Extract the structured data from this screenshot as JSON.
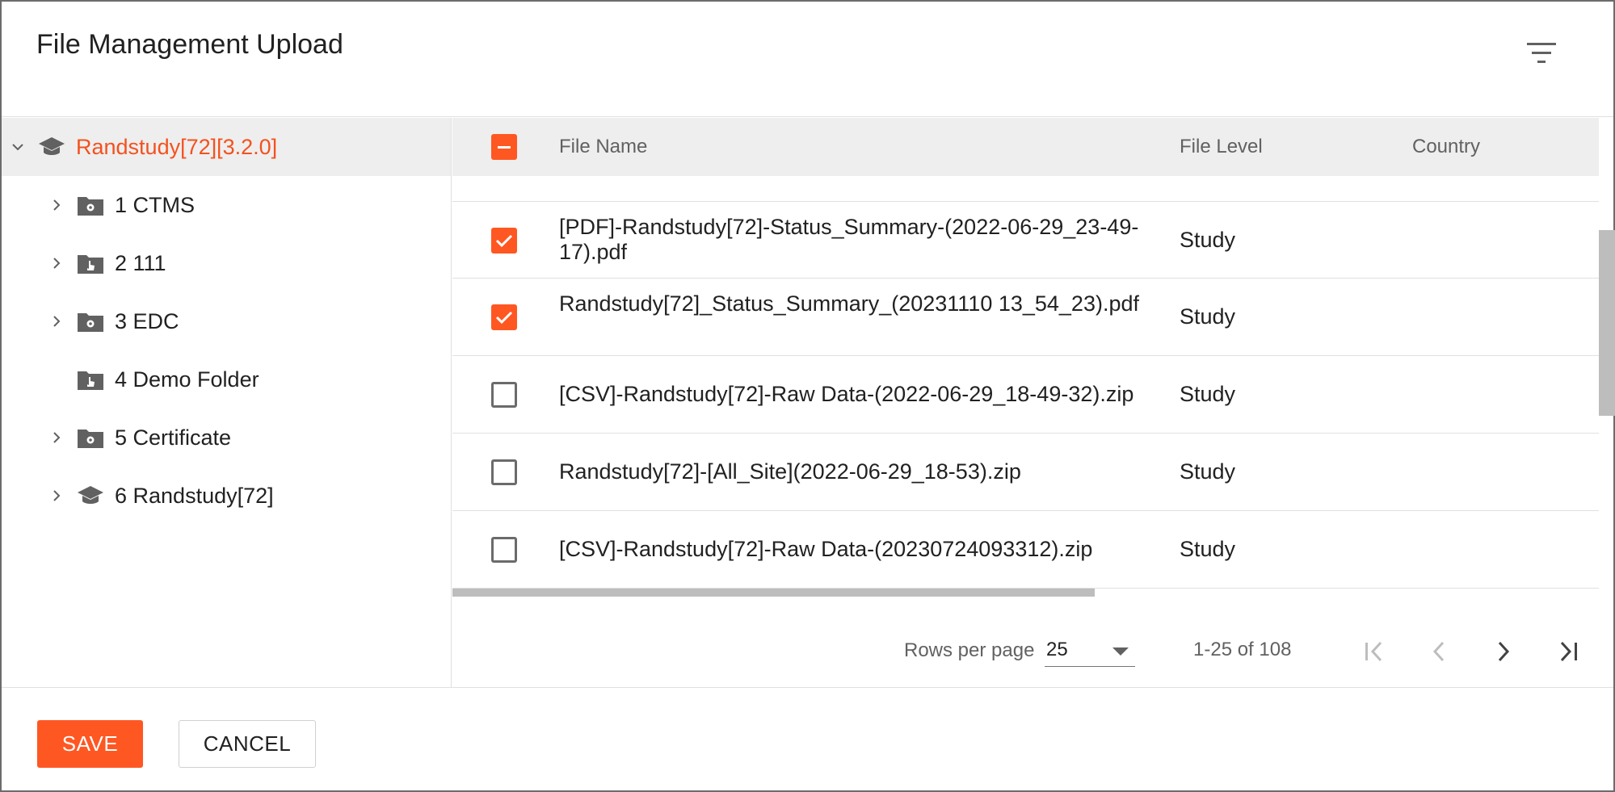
{
  "dialog": {
    "title": "File Management Upload"
  },
  "tree": {
    "root": {
      "label": "Randstudy[72][3.2.0]",
      "icon": "graduation-cap-icon"
    },
    "items": [
      {
        "label": "1 CTMS",
        "icon": "folder-gear-icon",
        "expandable": true
      },
      {
        "label": "2 111",
        "icon": "folder-pointer-icon",
        "expandable": true
      },
      {
        "label": "3 EDC",
        "icon": "folder-gear-icon",
        "expandable": true
      },
      {
        "label": "4 Demo Folder",
        "icon": "folder-pointer-icon",
        "expandable": false
      },
      {
        "label": "5 Certificate",
        "icon": "folder-gear-icon",
        "expandable": true
      },
      {
        "label": "6 Randstudy[72]",
        "icon": "graduation-cap-icon",
        "expandable": true
      }
    ]
  },
  "table": {
    "columns": [
      "File Name",
      "File Level",
      "Country"
    ],
    "select_all_state": "indeterminate",
    "rows": [
      {
        "checked": true,
        "file_name": "[PDF]-Randstudy[72]-Status_Summary-(2022-06-29_23-49-17).pdf",
        "file_level": "Study",
        "country": ""
      },
      {
        "checked": true,
        "file_name": "Randstudy[72]_Status_Summary_(20231110 13_54_23).pdf",
        "file_level": "Study",
        "country": ""
      },
      {
        "checked": false,
        "file_name": "[CSV]-Randstudy[72]-Raw Data-(2022-06-29_18-49-32).zip",
        "file_level": "Study",
        "country": ""
      },
      {
        "checked": false,
        "file_name": "Randstudy[72]-[All_Site](2022-06-29_18-53).zip",
        "file_level": "Study",
        "country": ""
      },
      {
        "checked": false,
        "file_name": "[CSV]-Randstudy[72]-Raw Data-(20230724093312).zip",
        "file_level": "Study",
        "country": ""
      }
    ]
  },
  "pagination": {
    "rows_per_page_label": "Rows per page",
    "rows_per_page_value": "25",
    "range": "1-25 of 108"
  },
  "footer": {
    "save_label": "SAVE",
    "cancel_label": "CANCEL"
  },
  "colors": {
    "accent": "#ff5722",
    "root_text": "#f4511e",
    "header_bg": "#eeeeee"
  }
}
